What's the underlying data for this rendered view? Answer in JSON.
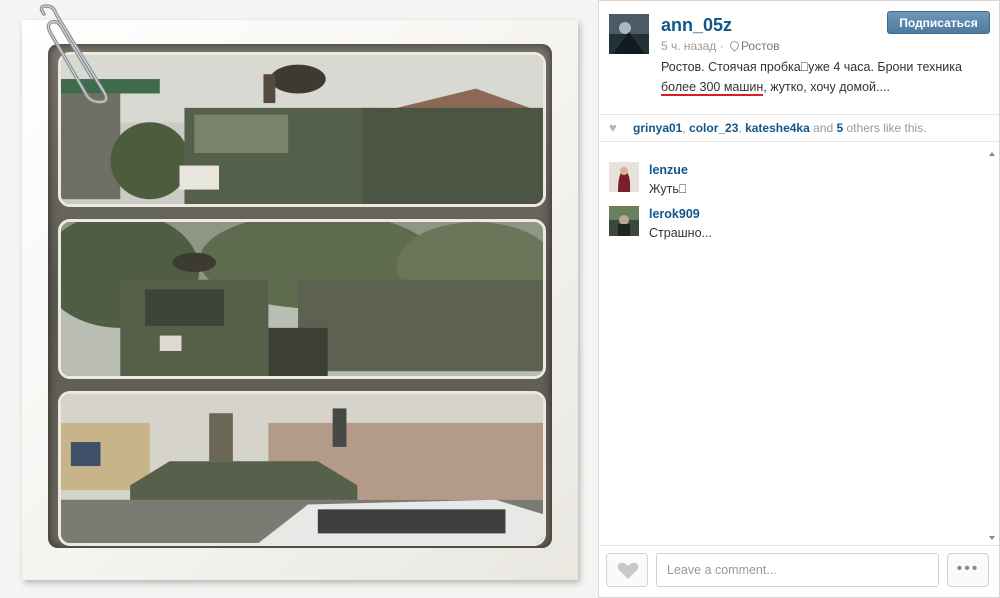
{
  "post": {
    "username": "ann_05z",
    "follow_label": "Подписаться",
    "time_ago": "5 ч. назад",
    "location": "Ростов",
    "caption_part1": "Ростов. Стоячая пробка⎕уже 4 часа. Брони техника ",
    "caption_underlined": "более 300 машин",
    "caption_part2": ", жутко, хочу домой....",
    "image_alt": "collage of three photos of military trucks and an armored vehicle on a street"
  },
  "likes": {
    "user1": "grinya01",
    "user2": "color_23",
    "user3": "kateshe4ka",
    "and_text": " and ",
    "others_count": "5",
    "suffix": " others like this."
  },
  "comments": [
    {
      "name": "lenzue",
      "text": "Жуть⎕"
    },
    {
      "name": "lerok909",
      "text": "Страшно..."
    }
  ],
  "footer": {
    "comment_placeholder": "Leave a comment...",
    "more_label": "•••"
  },
  "colors": {
    "link": "#125688",
    "follow_button": "#4c7aa0",
    "underline": "#d81e1e"
  }
}
